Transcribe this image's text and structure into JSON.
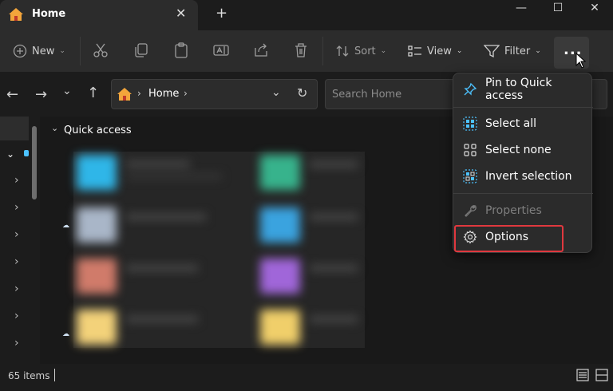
{
  "window": {
    "tab_title": "Home",
    "tab_close": "✕",
    "new_tab": "+",
    "minimize": "—",
    "maximize": "☐",
    "close": "✕"
  },
  "toolbar": {
    "new_label": "New",
    "sort_label": "Sort",
    "view_label": "View",
    "filter_label": "Filter",
    "more_label": "..."
  },
  "address": {
    "location": "Home",
    "search_placeholder": "Search Home"
  },
  "main": {
    "section_label": "Quick access"
  },
  "menu": {
    "items": [
      {
        "label": "Pin to Quick access",
        "icon": "pin-icon",
        "enabled": true
      },
      {
        "label": "Select all",
        "icon": "select-all-icon",
        "enabled": true
      },
      {
        "label": "Select none",
        "icon": "select-none-icon",
        "enabled": true
      },
      {
        "label": "Invert selection",
        "icon": "invert-selection-icon",
        "enabled": true
      },
      {
        "label": "Properties",
        "icon": "properties-icon",
        "enabled": false
      },
      {
        "label": "Options",
        "icon": "gear-icon",
        "enabled": true,
        "highlighted": true
      }
    ]
  },
  "status": {
    "item_count": "65 items"
  },
  "colors": {
    "accent": "#4cc2ff",
    "highlight_border": "#e0383e",
    "folder": "#f3c44d"
  }
}
